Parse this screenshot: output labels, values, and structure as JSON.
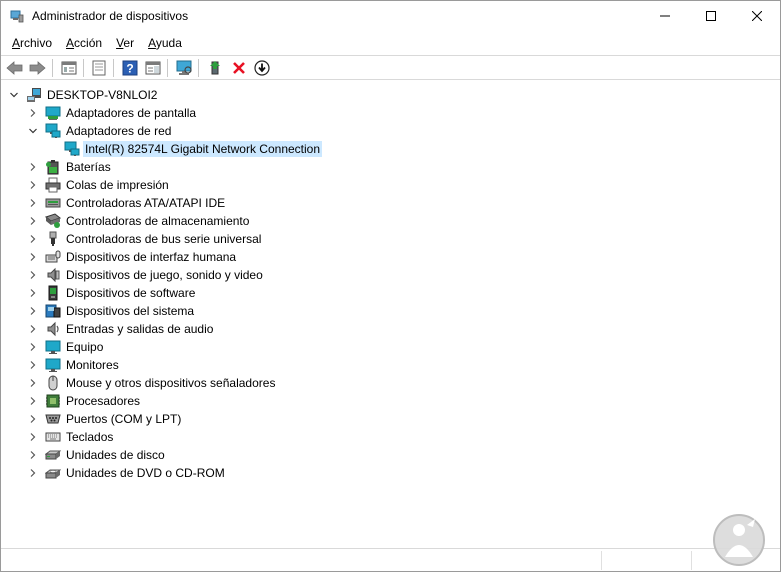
{
  "window": {
    "title": "Administrador de dispositivos",
    "controls": {
      "minimize": "minimize-icon",
      "maximize": "maximize-icon",
      "close": "close-icon"
    }
  },
  "menu": [
    {
      "label": "Archivo",
      "accel": "A",
      "rest": "rchivo"
    },
    {
      "label": "Acción",
      "accel": "A",
      "rest": "cción"
    },
    {
      "label": "Ver",
      "accel": "V",
      "rest": "er"
    },
    {
      "label": "Ayuda",
      "accel": "A",
      "rest": "yuda"
    }
  ],
  "toolbar": [
    {
      "name": "back-icon"
    },
    {
      "name": "forward-icon"
    },
    {
      "name": "console-tree-icon"
    },
    {
      "name": "properties-icon"
    },
    {
      "name": "help-icon"
    },
    {
      "name": "action-pane-icon"
    },
    {
      "name": "scan-hardware-icon"
    },
    {
      "name": "update-driver-icon"
    },
    {
      "name": "uninstall-icon"
    },
    {
      "name": "disable-device-icon"
    }
  ],
  "tree": {
    "root": {
      "label": "DESKTOP-V8NLOI2",
      "icon": "computer-icon",
      "expanded": true
    },
    "items": [
      {
        "label": "Adaptadores de pantalla",
        "icon": "display-adapter-icon",
        "expanded": false
      },
      {
        "label": "Adaptadores de red",
        "icon": "network-adapter-icon",
        "expanded": true,
        "children": [
          {
            "label": "Intel(R) 82574L Gigabit Network Connection",
            "icon": "network-adapter-icon",
            "selected": true
          }
        ]
      },
      {
        "label": "Baterías",
        "icon": "battery-icon",
        "expanded": false
      },
      {
        "label": "Colas de impresión",
        "icon": "printer-icon",
        "expanded": false
      },
      {
        "label": "Controladoras ATA/ATAPI IDE",
        "icon": "ide-controller-icon",
        "expanded": false
      },
      {
        "label": "Controladoras de almacenamiento",
        "icon": "storage-controller-icon",
        "expanded": false
      },
      {
        "label": "Controladoras de bus serie universal",
        "icon": "usb-icon",
        "expanded": false
      },
      {
        "label": "Dispositivos de interfaz humana",
        "icon": "hid-icon",
        "expanded": false
      },
      {
        "label": "Dispositivos de juego, sonido y video",
        "icon": "speaker-icon",
        "expanded": false
      },
      {
        "label": "Dispositivos de software",
        "icon": "software-device-icon",
        "expanded": false
      },
      {
        "label": "Dispositivos del sistema",
        "icon": "system-device-icon",
        "expanded": false
      },
      {
        "label": "Entradas y salidas de audio",
        "icon": "audio-io-icon",
        "expanded": false
      },
      {
        "label": "Equipo",
        "icon": "monitor-icon",
        "expanded": false
      },
      {
        "label": "Monitores",
        "icon": "monitor-icon",
        "expanded": false
      },
      {
        "label": "Mouse y otros dispositivos señaladores",
        "icon": "mouse-icon",
        "expanded": false
      },
      {
        "label": "Procesadores",
        "icon": "processor-icon",
        "expanded": false
      },
      {
        "label": "Puertos (COM y LPT)",
        "icon": "port-icon",
        "expanded": false
      },
      {
        "label": "Teclados",
        "icon": "keyboard-icon",
        "expanded": false
      },
      {
        "label": "Unidades de disco",
        "icon": "disk-drive-icon",
        "expanded": false
      },
      {
        "label": "Unidades de DVD o CD-ROM",
        "icon": "dvd-drive-icon",
        "expanded": false
      }
    ]
  },
  "colors": {
    "selection": "#cce8ff",
    "accent_teal": "#1fa8c9",
    "error_red": "#e81123"
  }
}
